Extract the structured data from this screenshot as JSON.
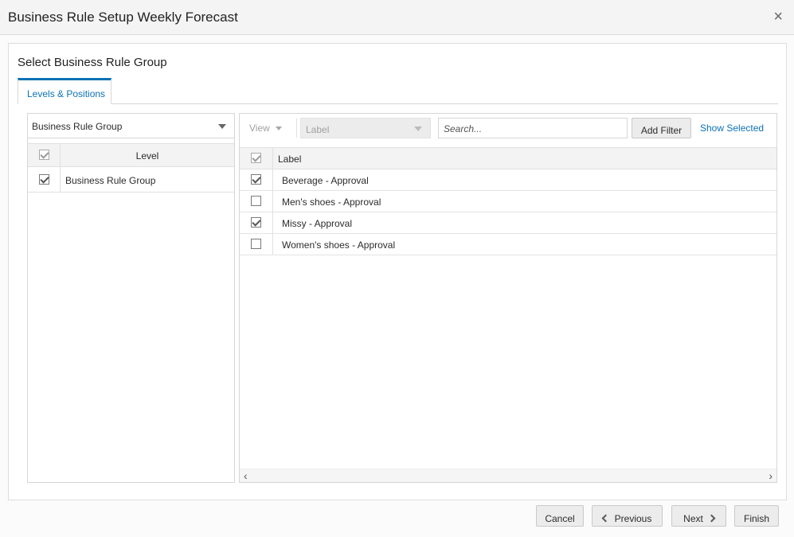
{
  "dialog": {
    "title": "Business Rule Setup Weekly Forecast",
    "close_glyph": "×"
  },
  "panel": {
    "title": "Select Business Rule Group",
    "tabs": [
      {
        "label": "Levels & Positions",
        "active": true
      }
    ]
  },
  "left": {
    "dropdown_value": "Business Rule Group",
    "column_header": "Level",
    "header_checked": true,
    "rows": [
      {
        "label": "Business Rule Group",
        "checked": true
      }
    ]
  },
  "right": {
    "toolbar": {
      "view_label": "View",
      "label_select_placeholder": "Label",
      "search_placeholder": "Search...",
      "add_filter_label": "Add Filter",
      "show_selected_label": "Show Selected"
    },
    "column_header": "Label",
    "header_checked": true,
    "rows": [
      {
        "label": "Beverage - Approval",
        "checked": true
      },
      {
        "label": "Men's shoes - Approval",
        "checked": false
      },
      {
        "label": "Missy - Approval",
        "checked": true
      },
      {
        "label": "Women's shoes - Approval",
        "checked": false
      }
    ],
    "scroll_left_glyph": "‹",
    "scroll_right_glyph": "›"
  },
  "footer": {
    "cancel_label": "Cancel",
    "previous_label": "Previous",
    "next_label": "Next",
    "finish_label": "Finish"
  },
  "colors": {
    "accent": "#0b72b5",
    "header_bg": "#f4f4f4",
    "button_bg": "#ececec"
  }
}
